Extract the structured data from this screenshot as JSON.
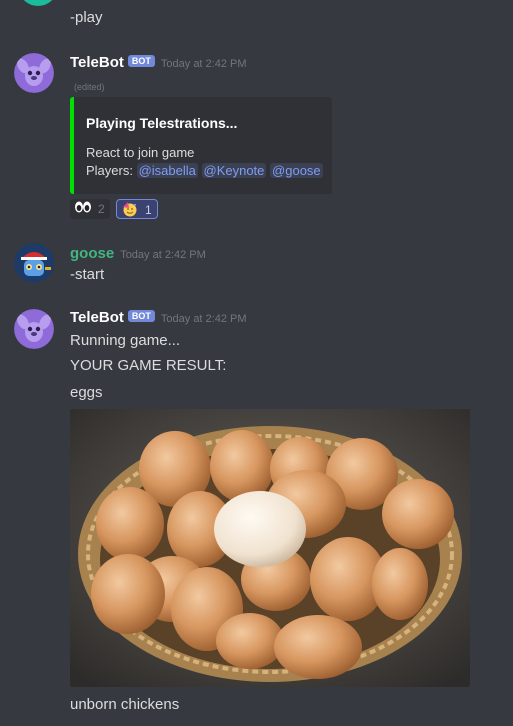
{
  "messages": {
    "play": {
      "text": "-play"
    },
    "bot1": {
      "username": "TeleBot",
      "bot_tag": "BOT",
      "timestamp": "Today at 2:42 PM",
      "edited": "(edited)",
      "embed": {
        "title": "Playing Telestrations...",
        "line1": "React to join game",
        "players_label": "Players:",
        "players": [
          "@isabella",
          "@Keynote",
          "@goose"
        ],
        "accent_color": "#00e000"
      },
      "reactions": [
        {
          "emoji": "eyes-emoji",
          "count": "2",
          "active": false
        },
        {
          "emoji": "partying-face-emoji",
          "count": "1",
          "active": true
        }
      ]
    },
    "goose": {
      "username": "goose",
      "username_color": "#43b581",
      "timestamp": "Today at 2:42 PM",
      "text": "-start"
    },
    "bot2": {
      "username": "TeleBot",
      "bot_tag": "BOT",
      "timestamp": "Today at 2:42 PM",
      "line1": "Running game...",
      "line2": "YOUR GAME RESULT:",
      "line3": "eggs",
      "image": "basket-of-eggs-photo",
      "caption": "unborn chickens"
    }
  }
}
